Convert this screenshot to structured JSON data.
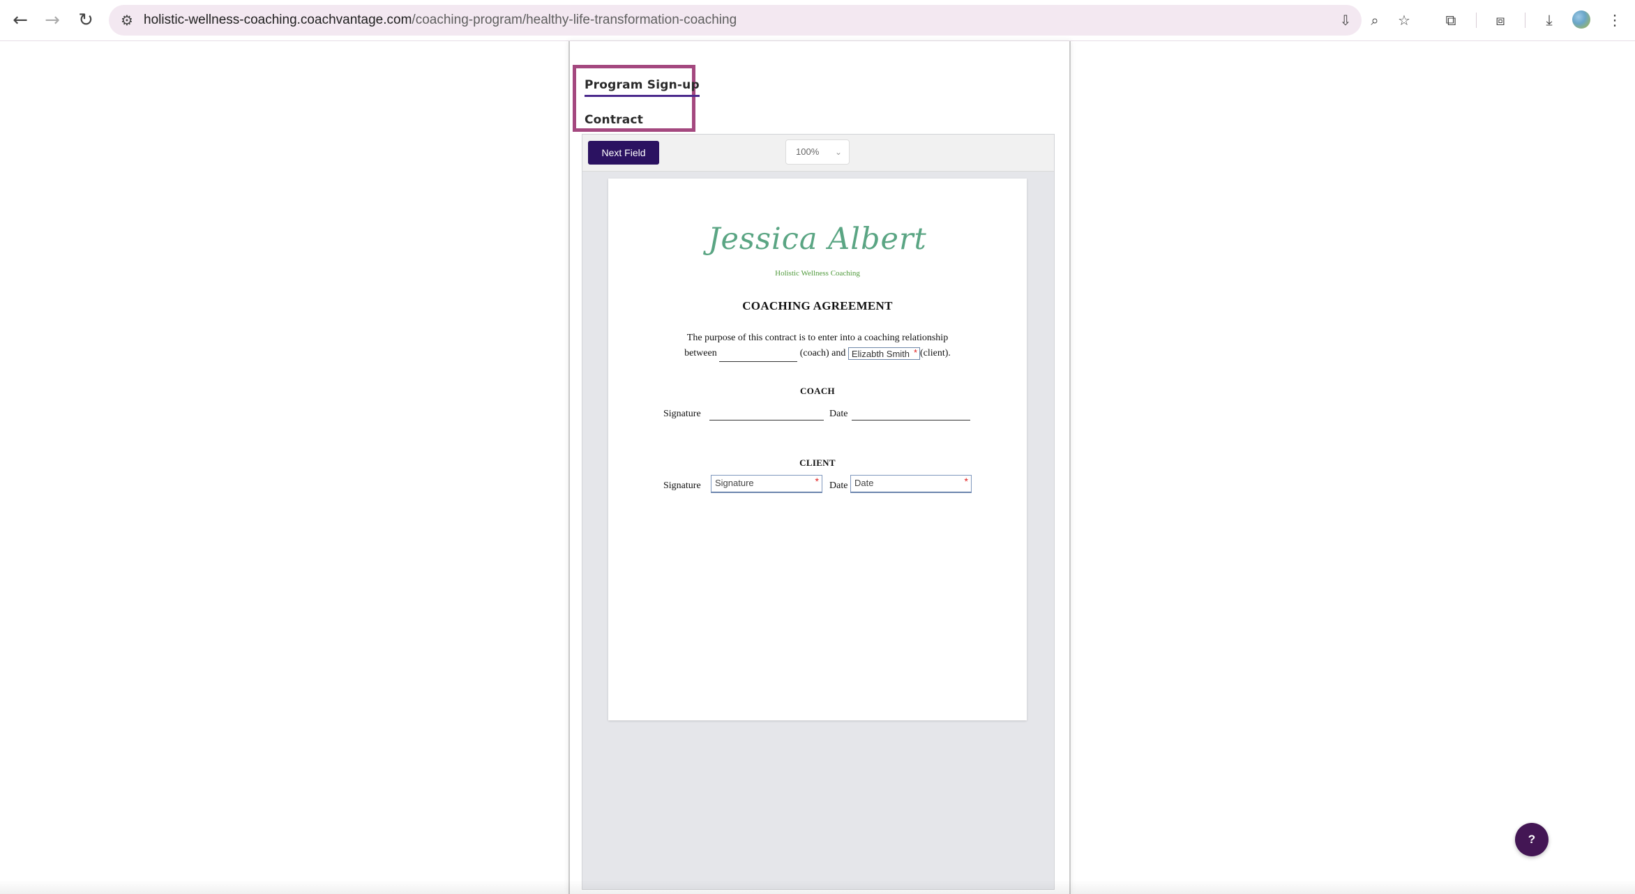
{
  "browser": {
    "url_host": "holistic-wellness-coaching.coachvantage.com",
    "url_path": "/coaching-program/healthy-life-transformation-coaching",
    "icons": {
      "back": "←",
      "forward": "→",
      "reload": "↻",
      "site_info": "⚙",
      "install": "⇩",
      "zoom": "⌕",
      "bookmark": "☆",
      "extensions": "⧉",
      "cast": "⧈",
      "downloads": "⤓",
      "menu": "⋮"
    }
  },
  "tabs": {
    "signup_label": "Program Sign-up",
    "contract_label": "Contract"
  },
  "viewer": {
    "next_field_label": "Next Field",
    "zoom_value": "100%",
    "zoom_caret": "⌄"
  },
  "document": {
    "logo_name": "Jessica Albert",
    "logo_subtitle": "Holistic Wellness Coaching",
    "title": "COACHING AGREEMENT",
    "purpose_text_1": "The purpose of this contract is to enter into a coaching relationship",
    "purpose_between": "between",
    "purpose_coach": "(coach) and",
    "client_name_value": "Elizabth Smith",
    "purpose_client": "(client).",
    "required_mark": "*",
    "coach_heading": "COACH",
    "client_heading": "CLIENT",
    "signature_label": "Signature",
    "date_label": "Date",
    "client_signature_placeholder": "Signature",
    "client_date_placeholder": "Date"
  },
  "help": {
    "label": "?"
  },
  "colors": {
    "brand_purple": "#2b1261",
    "highlight_border": "#a4487f",
    "help_button": "#431654",
    "logo_green": "#5aa583"
  }
}
